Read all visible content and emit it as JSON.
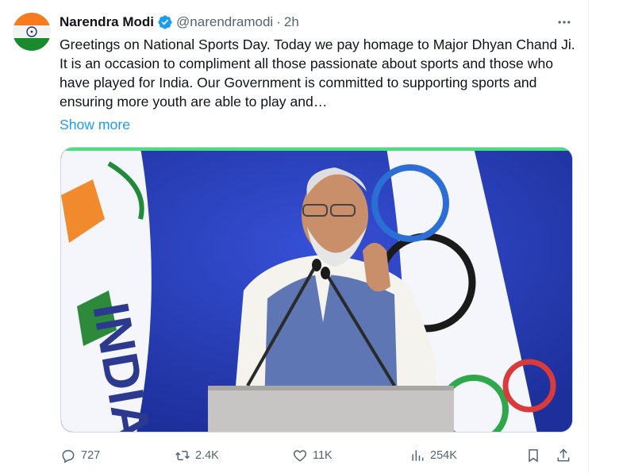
{
  "tweet": {
    "author": {
      "name": "Narendra Modi",
      "handle": "@narendramodi",
      "separator": "·",
      "time": "2h",
      "verified_icon": "verified-badge-icon",
      "avatar": "india-flag-avatar"
    },
    "text": "Greetings on National Sports Day. Today we pay homage to Major Dhyan Chand Ji. It is an occasion to compliment all those passionate about sports and those who have played for India. Our Government is committed to supporting sports and ensuring more youth are able to play and…",
    "show_more": "Show more",
    "media": {
      "type": "video",
      "flag_text": "INDIA"
    },
    "actions": {
      "replies": "727",
      "retweets": "2.4K",
      "likes": "11K",
      "views": "254K"
    }
  },
  "colors": {
    "accent": "#1d9bf0",
    "muted": "#536471",
    "verified": "#1d9bf0",
    "progress": "#4ade80"
  }
}
